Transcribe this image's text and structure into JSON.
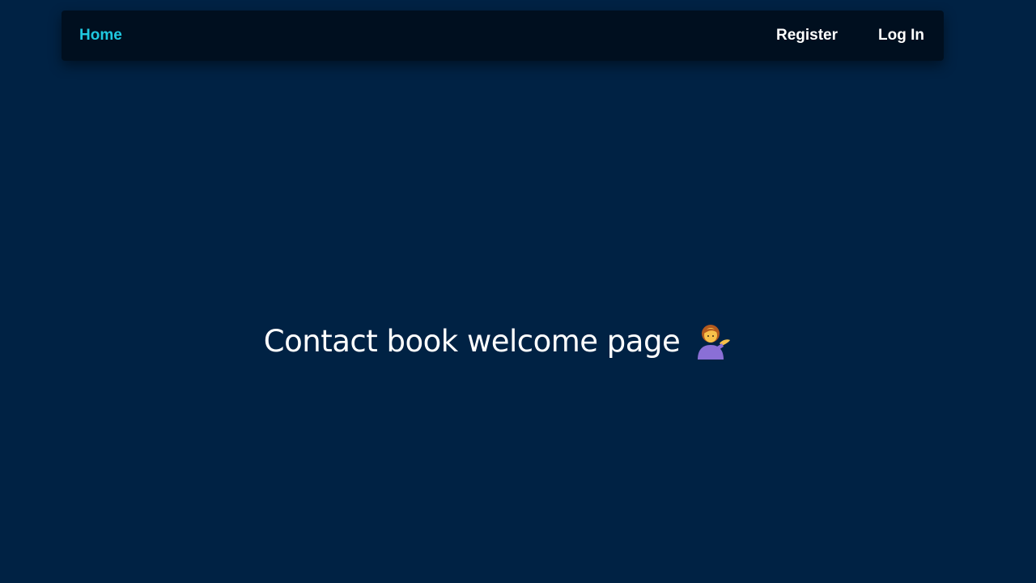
{
  "nav": {
    "home_label": "Home",
    "register_label": "Register",
    "login_label": "Log In"
  },
  "hero": {
    "title": "Contact book welcome page",
    "emoji_icon": "woman-tipping-hand-icon"
  },
  "colors": {
    "background": "#002244",
    "navbar": "#000f1f",
    "accent": "#1fc8e0",
    "text": "#ffffff"
  }
}
